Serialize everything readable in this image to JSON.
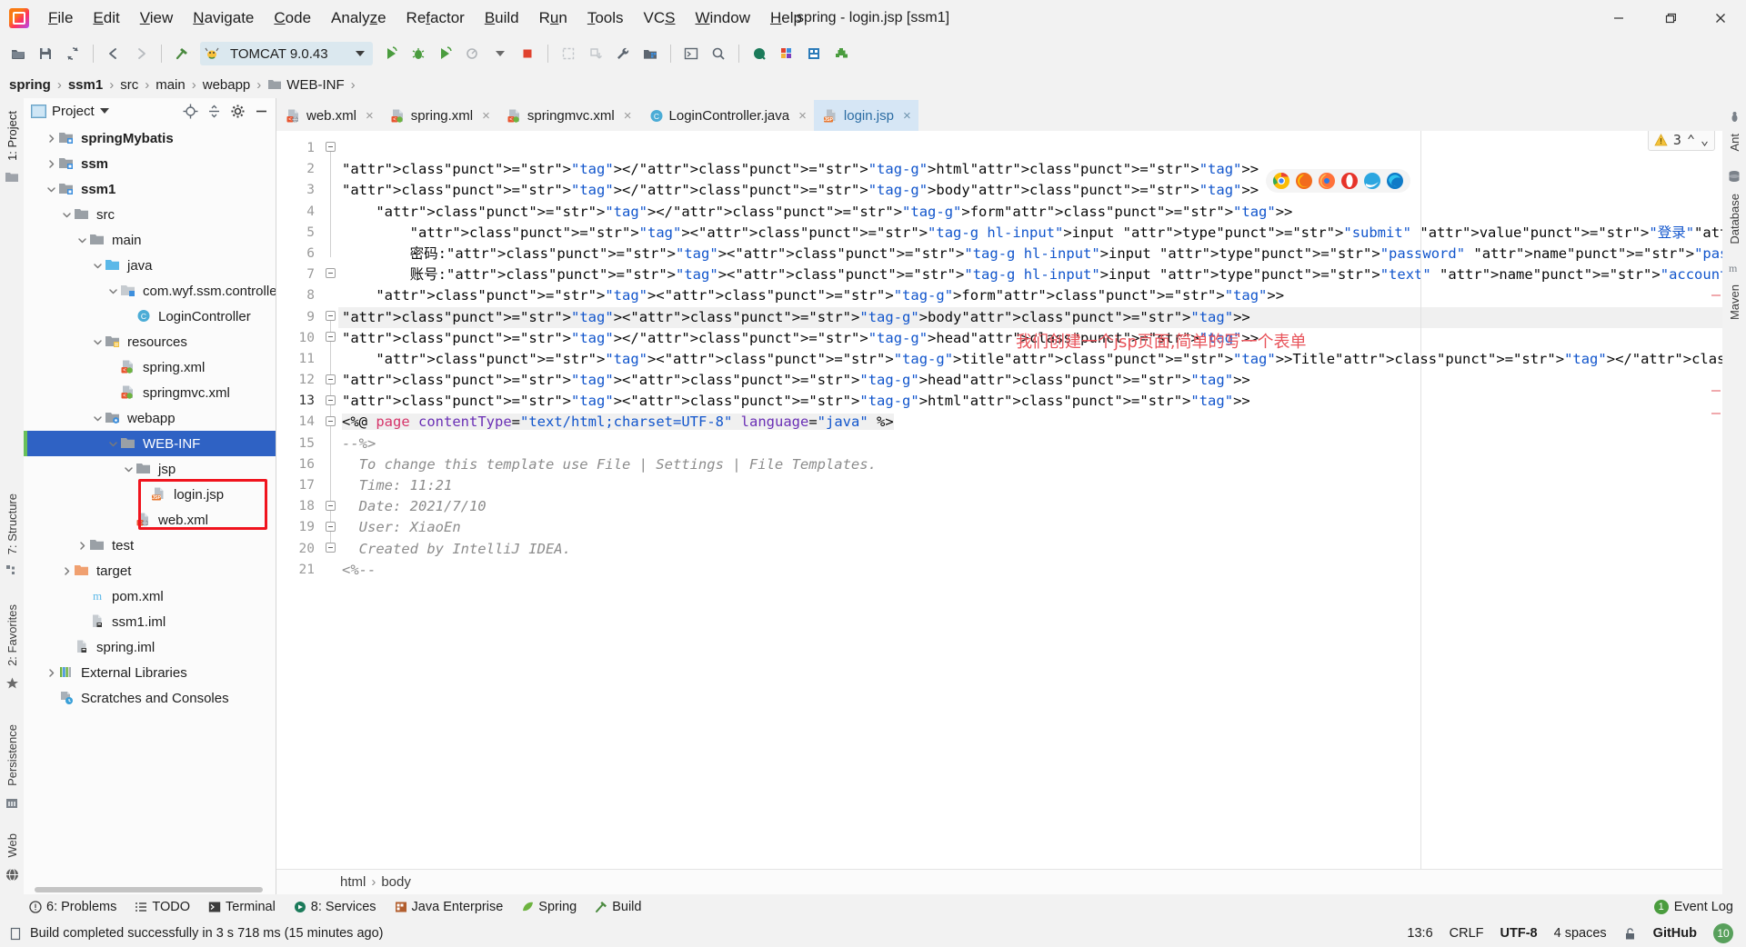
{
  "window": {
    "title": "spring - login.jsp [ssm1]",
    "minimize": "—",
    "maximize": "❐",
    "close": "✕"
  },
  "menu": [
    {
      "label": "File"
    },
    {
      "label": "Edit"
    },
    {
      "label": "View"
    },
    {
      "label": "Navigate"
    },
    {
      "label": "Code"
    },
    {
      "label": "Analyze"
    },
    {
      "label": "Refactor"
    },
    {
      "label": "Build"
    },
    {
      "label": "Run"
    },
    {
      "label": "Tools"
    },
    {
      "label": "VCS"
    },
    {
      "label": "Window"
    },
    {
      "label": "Help"
    }
  ],
  "toolbar": {
    "run_config": "TOMCAT 9.0.43",
    "icons": [
      "open-project-icon",
      "save-all-icon",
      "sync-icon",
      "back-arrow-icon",
      "forward-arrow-icon",
      "build-hammer-icon",
      "run-config-icon",
      "run-icon",
      "debug-icon",
      "run-with-coverage-icon",
      "profile-icon",
      "stop-icon",
      "update-app-icon",
      "deploy-icon",
      "settings-wrench-icon",
      "project-structure-icon",
      "terminal-icon",
      "search-everywhere-icon",
      "search-magnifier-icon",
      "database-icon",
      "colors-icon",
      "ui-designer-icon",
      "plugin-icon"
    ]
  },
  "breadcrumb": [
    "spring",
    "ssm1",
    "src",
    "main",
    "webapp",
    "WEB-INF"
  ],
  "project_panel": {
    "title": "Project",
    "header_icons": [
      "target-locate-icon",
      "collapse-all-icon",
      "gear-icon",
      "hide-icon"
    ],
    "tree": [
      {
        "label": "springMybatis",
        "indent": 1,
        "arrow": "right",
        "icon": "module-folder-icon",
        "bold": true,
        "selected": false
      },
      {
        "label": "ssm",
        "indent": 1,
        "arrow": "right",
        "icon": "module-folder-icon",
        "bold": true,
        "selected": false
      },
      {
        "label": "ssm1",
        "indent": 1,
        "arrow": "down",
        "icon": "module-folder-icon",
        "bold": true,
        "selected": false
      },
      {
        "label": "src",
        "indent": 2,
        "arrow": "down",
        "icon": "folder-icon",
        "bold": false,
        "selected": false
      },
      {
        "label": "main",
        "indent": 3,
        "arrow": "down",
        "icon": "folder-icon",
        "bold": false,
        "selected": false
      },
      {
        "label": "java",
        "indent": 4,
        "arrow": "down",
        "icon": "source-folder-icon",
        "bold": false,
        "selected": false
      },
      {
        "label": "com.wyf.ssm.controller",
        "indent": 5,
        "arrow": "down",
        "icon": "package-icon",
        "bold": false,
        "selected": false
      },
      {
        "label": "LoginController",
        "indent": 6,
        "arrow": "none",
        "icon": "java-class-icon",
        "bold": false,
        "selected": false
      },
      {
        "label": "resources",
        "indent": 4,
        "arrow": "down",
        "icon": "resources-folder-icon",
        "bold": false,
        "selected": false
      },
      {
        "label": "spring.xml",
        "indent": 5,
        "arrow": "none",
        "icon": "xml-spring-icon",
        "bold": false,
        "selected": false
      },
      {
        "label": "springmvc.xml",
        "indent": 5,
        "arrow": "none",
        "icon": "xml-spring-icon",
        "bold": false,
        "selected": false
      },
      {
        "label": "webapp",
        "indent": 4,
        "arrow": "down",
        "icon": "web-folder-icon",
        "bold": false,
        "selected": false
      },
      {
        "label": "WEB-INF",
        "indent": 5,
        "arrow": "down",
        "icon": "folder-icon",
        "bold": false,
        "selected": true
      },
      {
        "label": "jsp",
        "indent": 6,
        "arrow": "down",
        "icon": "folder-icon",
        "bold": false,
        "selected": false
      },
      {
        "label": "login.jsp",
        "indent": 7,
        "arrow": "none",
        "icon": "jsp-file-icon",
        "bold": false,
        "selected": false
      },
      {
        "label": "web.xml",
        "indent": 6,
        "arrow": "none",
        "icon": "xml-web-icon",
        "bold": false,
        "selected": false
      },
      {
        "label": "test",
        "indent": 3,
        "arrow": "right",
        "icon": "folder-icon",
        "bold": false,
        "selected": false
      },
      {
        "label": "target",
        "indent": 2,
        "arrow": "right",
        "icon": "excluded-folder-icon",
        "bold": false,
        "selected": false
      },
      {
        "label": "pom.xml",
        "indent": 3,
        "arrow": "none",
        "icon": "maven-icon",
        "bold": false,
        "selected": false
      },
      {
        "label": "ssm1.iml",
        "indent": 3,
        "arrow": "none",
        "icon": "iml-icon",
        "bold": false,
        "selected": false
      },
      {
        "label": "spring.iml",
        "indent": 2,
        "arrow": "none",
        "icon": "iml-icon",
        "bold": false,
        "selected": false
      },
      {
        "label": "External Libraries",
        "indent": 1,
        "arrow": "right",
        "icon": "libraries-icon",
        "bold": false,
        "selected": false
      },
      {
        "label": "Scratches and Consoles",
        "indent": 1,
        "arrow": "none",
        "icon": "scratches-icon",
        "bold": false,
        "selected": false
      }
    ]
  },
  "left_rail": {
    "top": [
      "1: Project"
    ],
    "middle": [
      "7: Structure",
      "2: Favorites"
    ],
    "bottom": [
      "Persistence",
      "Web"
    ]
  },
  "right_rail": [
    "Ant",
    "Database",
    "Maven"
  ],
  "editor": {
    "tabs": [
      {
        "label": "web.xml",
        "icon": "xml-web-icon",
        "active": false,
        "close": "×"
      },
      {
        "label": "spring.xml",
        "icon": "xml-spring-icon",
        "active": false,
        "close": "×"
      },
      {
        "label": "springmvc.xml",
        "icon": "xml-spring-icon",
        "active": false,
        "close": "×"
      },
      {
        "label": "LoginController.java",
        "icon": "java-class-icon",
        "active": false,
        "close": "×"
      },
      {
        "label": "login.jsp",
        "icon": "jsp-file-icon",
        "active": true,
        "close": "×"
      }
    ],
    "line_numbers": [
      "1",
      "2",
      "3",
      "4",
      "5",
      "6",
      "7",
      "8",
      "9",
      "10",
      "11",
      "12",
      "13",
      "14",
      "15",
      "16",
      "17",
      "18",
      "19",
      "20",
      "21"
    ],
    "current_line": 13,
    "code_lines": [
      "<%--",
      "  Created by IntelliJ IDEA.",
      "  User: XiaoEn",
      "  Date: 2021/7/10",
      "  Time: 11:21",
      "  To change this template use File | Settings | File Templates.",
      "--%>",
      "<%@ page contentType=\"text/html;charset=UTF-8\" language=\"java\" %>",
      "<html>",
      "<head>",
      "    <title>Title</title>",
      "</head>",
      "<body>",
      "    <form>",
      "        账号:<input type=\"text\" name=\"account\">",
      "        密码:<input type=\"password\" name=\"password\">",
      "        <input type=\"submit\" value=\"登录\">",
      "    </form>",
      "</body>",
      "</html>",
      ""
    ],
    "annotation": "我们创建一个jsp页面,简单的写一个表单",
    "annotation_color": "#e8545b",
    "inspection_count": "3",
    "inspection_up": "⌃",
    "inspection_down": "⌄",
    "breadcrumb": [
      "html",
      "body"
    ],
    "browser_icons": [
      "chrome-icon",
      "firefox-developer-icon",
      "firefox-icon",
      "opera-icon",
      "internet-explorer-icon",
      "edge-icon"
    ]
  },
  "toolwindow_bar": {
    "items": [
      {
        "label": "6: Problems",
        "icon": "problems-icon"
      },
      {
        "label": "TODO",
        "icon": "todo-icon"
      },
      {
        "label": "Terminal",
        "icon": "terminal-icon"
      },
      {
        "label": "8: Services",
        "icon": "services-icon"
      },
      {
        "label": "Java Enterprise",
        "icon": "java-enterprise-icon"
      },
      {
        "label": "Spring",
        "icon": "spring-leaf-icon"
      },
      {
        "label": "Build",
        "icon": "build-hammer-icon"
      }
    ],
    "event_log": "Event Log",
    "event_log_count": "1"
  },
  "statusbar": {
    "message": "Build completed successfully in 3 s 718 ms (15 minutes ago)",
    "caret": "13:6",
    "line_separator": "CRLF",
    "encoding": "UTF-8",
    "indent": "4 spaces",
    "lock_icon": "unlocked-icon",
    "vcs": "GitHub",
    "avatar_badge": "10"
  }
}
